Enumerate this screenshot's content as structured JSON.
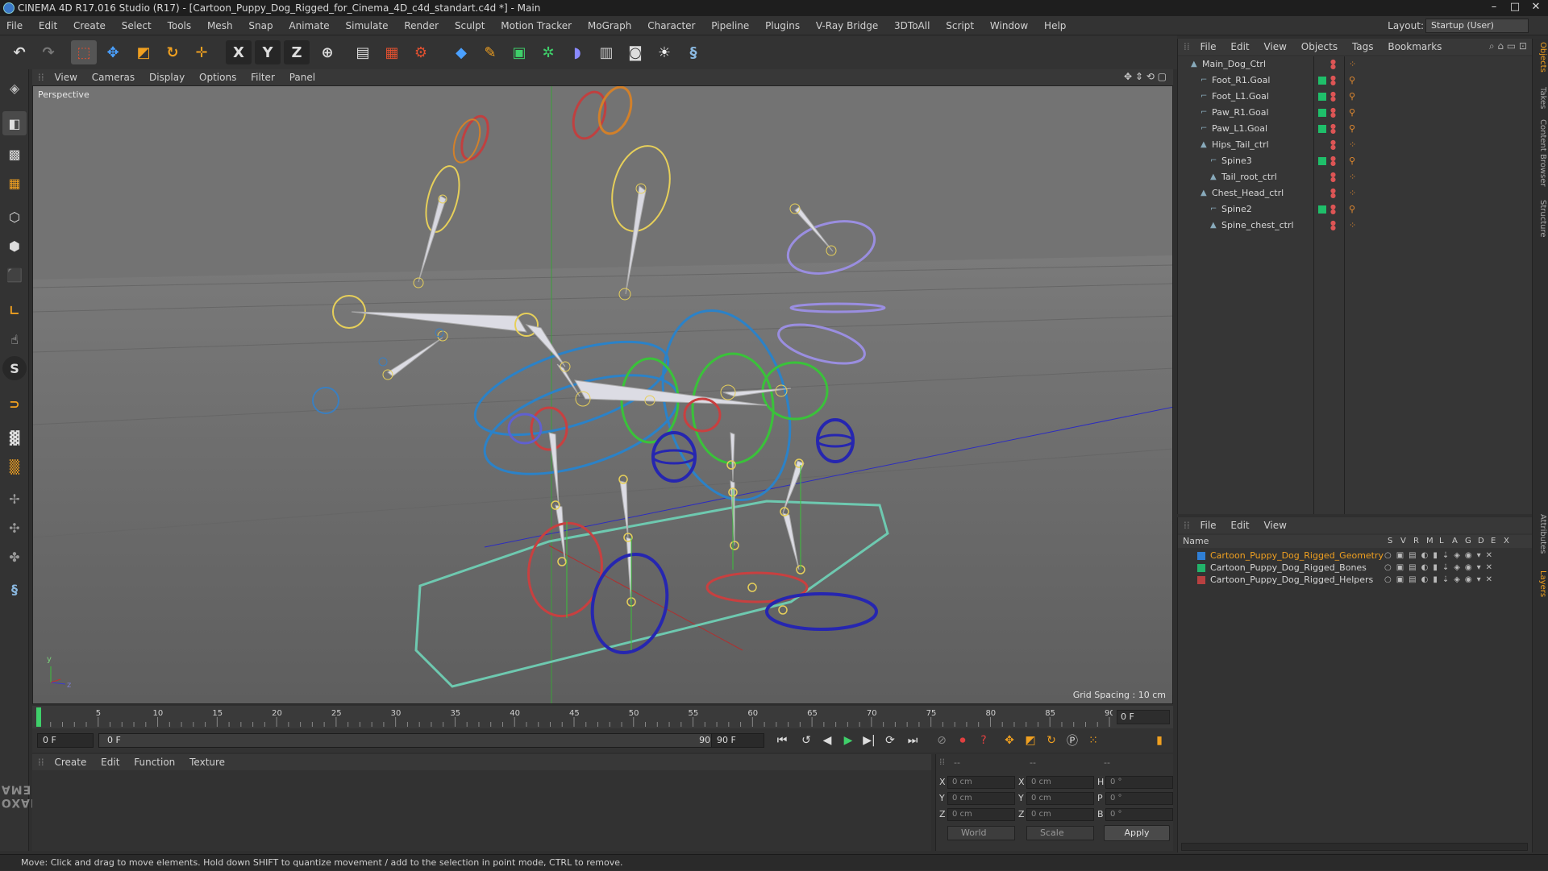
{
  "window": {
    "title": "CINEMA 4D R17.016 Studio (R17) - [Cartoon_Puppy_Dog_Rigged_for_Cinema_4D_c4d_standart.c4d *] - Main",
    "controls": [
      "–",
      "□",
      "✕"
    ]
  },
  "menubar": {
    "items": [
      "File",
      "Edit",
      "Create",
      "Select",
      "Tools",
      "Mesh",
      "Snap",
      "Animate",
      "Simulate",
      "Render",
      "Sculpt",
      "Motion Tracker",
      "MoGraph",
      "Character",
      "Pipeline",
      "Plugins",
      "V-Ray Bridge",
      "3DToAll",
      "Script",
      "Window",
      "Help"
    ],
    "layout_label": "Layout:",
    "layout_value": "Startup (User)"
  },
  "toolbar": {
    "axis_x": "X",
    "axis_y": "Y",
    "axis_z": "Z",
    "icons": [
      "undo-icon",
      "redo-icon",
      "live-select-icon",
      "move-icon",
      "scale-icon",
      "rotate-icon",
      "last-tool-icon",
      "x-axis-icon",
      "y-axis-icon",
      "z-axis-icon",
      "world-coordinates-icon",
      "render-view-icon",
      "render-picture-viewer-icon",
      "edit-render-settings-icon",
      "cube-icon",
      "spline-pen-icon",
      "subdivision-icon",
      "array-icon",
      "deformer-icon",
      "floor-icon",
      "camera-icon",
      "light-icon",
      "python-icon"
    ]
  },
  "lefttools": {
    "icons": [
      "make-editable-icon",
      "model-mode-icon",
      "texture-mode-icon",
      "workplane-icon",
      "points-mode-icon",
      "edges-mode-icon",
      "polygons-mode-icon",
      "axis-mode-icon",
      "tweak-mode-icon",
      "snap-icon",
      "magnet-icon",
      "workplane-grid-icon",
      "locked-workplane-icon",
      "knife-icon",
      "brush-icon",
      "python-icon"
    ],
    "s_label": "S"
  },
  "branding": {
    "maxon": "MAXON",
    "cinema": "CINEMA 4D"
  },
  "viewport": {
    "menu": [
      "View",
      "Cameras",
      "Display",
      "Options",
      "Filter",
      "Panel"
    ],
    "camera_label": "Perspective",
    "grid_spacing": "Grid Spacing : 10 cm",
    "axis_y": "y",
    "axis_z": "z"
  },
  "timeline": {
    "ticks": [
      "0",
      "5",
      "10",
      "15",
      "20",
      "25",
      "30",
      "35",
      "40",
      "45",
      "50",
      "55",
      "60",
      "65",
      "70",
      "75",
      "80",
      "85",
      "90"
    ],
    "current_frame_right": "0 F"
  },
  "transport": {
    "start_frame": "0 F",
    "scrub_start": "0 F",
    "scrub_end": "90 F",
    "end_frame": "90 F",
    "icons": [
      "go-to-start-icon",
      "loop-icon",
      "prev-frame-icon",
      "play-icon",
      "next-frame-icon",
      "repeat-icon",
      "go-to-end-icon",
      "record-keys-icon",
      "autokey-icon",
      "keyframe-selection-icon",
      "position-key-icon",
      "scale-key-icon",
      "rotation-key-icon",
      "parameter-key-icon",
      "pla-key-icon",
      "timeline-icon"
    ]
  },
  "material": {
    "menu": [
      "Create",
      "Edit",
      "Function",
      "Texture"
    ]
  },
  "coordinates": {
    "col_headers": [
      "--",
      "--",
      "--"
    ],
    "rows": [
      {
        "l1": "X",
        "v1": "0 cm",
        "l2": "X",
        "v2": "0 cm",
        "l3": "H",
        "v3": "0 °"
      },
      {
        "l1": "Y",
        "v1": "0 cm",
        "l2": "Y",
        "v2": "0 cm",
        "l3": "P",
        "v3": "0 °"
      },
      {
        "l1": "Z",
        "v1": "0 cm",
        "l2": "Z",
        "v2": "0 cm",
        "l3": "B",
        "v3": "0 °"
      }
    ],
    "space_select": "World",
    "mode_select": "Scale",
    "apply": "Apply"
  },
  "status": {
    "text": "Move: Click and drag to move elements. Hold down SHIFT to quantize movement / add to the selection in point mode, CTRL to remove."
  },
  "objects": {
    "menu": [
      "File",
      "Edit",
      "View",
      "Objects",
      "Tags",
      "Bookmarks"
    ],
    "items": [
      {
        "name": "Main_Dog_Ctrl",
        "depth": 0,
        "green": false
      },
      {
        "name": "Foot_R1.Goal",
        "depth": 1,
        "green": true
      },
      {
        "name": "Foot_L1.Goal",
        "depth": 1,
        "green": true
      },
      {
        "name": "Paw_R1.Goal",
        "depth": 1,
        "green": true
      },
      {
        "name": "Paw_L1.Goal",
        "depth": 1,
        "green": true
      },
      {
        "name": "Hips_Tail_ctrl",
        "depth": 1,
        "green": false
      },
      {
        "name": "Spine3",
        "depth": 2,
        "green": true
      },
      {
        "name": "Tail_root_ctrl",
        "depth": 2,
        "green": false
      },
      {
        "name": "Chest_Head_ctrl",
        "depth": 1,
        "green": false
      },
      {
        "name": "Spine2",
        "depth": 2,
        "green": true
      },
      {
        "name": "Spine_chest_ctrl",
        "depth": 2,
        "green": false
      }
    ]
  },
  "layers": {
    "menu": [
      "File",
      "Edit",
      "View"
    ],
    "header_name": "Name",
    "header_flags": [
      "S",
      "V",
      "R",
      "M",
      "L",
      "A",
      "G",
      "D",
      "E",
      "X"
    ],
    "items": [
      {
        "name": "Cartoon_Puppy_Dog_Rigged_Geometry",
        "color": "#2f7fd6",
        "text_color": "#f0a020"
      },
      {
        "name": "Cartoon_Puppy_Dog_Rigged_Bones",
        "color": "#22b36a",
        "text_color": "#d6d6d6"
      },
      {
        "name": "Cartoon_Puppy_Dog_Rigged_Helpers",
        "color": "#b84040",
        "text_color": "#d6d6d6"
      }
    ]
  },
  "right_tabs": [
    "Objects",
    "Takes",
    "Content Browser",
    "Structure",
    "Attributes",
    "Layers"
  ],
  "colors": {
    "accent": "#3a78c7",
    "viewport_bg": "#6e6e6e",
    "panel_bg": "#333333",
    "green_tag": "#1fbf6a",
    "selected_layer": "#f0a020"
  }
}
